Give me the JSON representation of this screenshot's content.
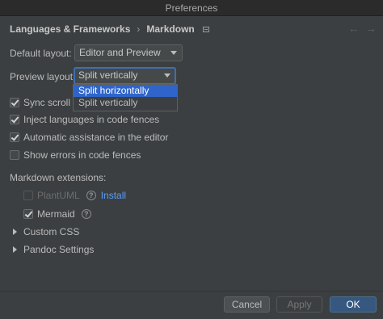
{
  "window": {
    "title": "Preferences"
  },
  "breadcrumb": {
    "parent": "Languages & Frameworks",
    "separator": "›",
    "current": "Markdown"
  },
  "nav": {
    "back": "←",
    "forward": "→"
  },
  "default_layout": {
    "label": "Default layout:",
    "value": "Editor and Preview"
  },
  "preview_layout": {
    "label": "Preview layout:",
    "value": "Split vertically",
    "options": [
      {
        "label": "Split horizontally",
        "selected": true
      },
      {
        "label": "Split vertically",
        "selected": false
      }
    ]
  },
  "checkboxes": [
    {
      "label": "Sync scroll in",
      "checked": true
    },
    {
      "label": "Inject languages in code fences",
      "checked": true
    },
    {
      "label": "Automatic assistance in the editor",
      "checked": true
    },
    {
      "label": "Show errors in code fences",
      "checked": false
    }
  ],
  "extensions": {
    "heading": "Markdown extensions:",
    "plantuml": {
      "label": "PlantUML",
      "checked": false,
      "disabled": true,
      "help": "?",
      "link": "Install"
    },
    "mermaid": {
      "label": "Mermaid",
      "checked": true,
      "help": "?"
    }
  },
  "expanders": [
    {
      "label": "Custom CSS"
    },
    {
      "label": "Pandoc Settings"
    }
  ],
  "footer": {
    "cancel": "Cancel",
    "apply": "Apply",
    "ok": "OK"
  }
}
